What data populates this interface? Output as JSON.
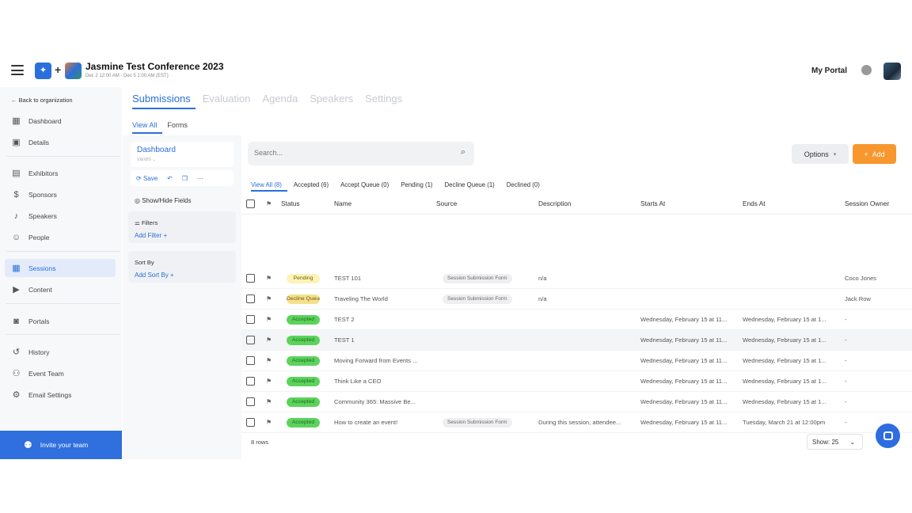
{
  "header": {
    "title": "Jasmine Test Conference 2023",
    "dates": "Dec 2 12:00 AM - Dec 5 1:00 AM (EST)",
    "my_portal": "My Portal"
  },
  "sidebar": {
    "back": "← Back to organization",
    "items": [
      {
        "label": "Dashboard",
        "icon": "dashboard-icon"
      },
      {
        "label": "Details",
        "icon": "calendar-icon"
      },
      {
        "label": "Exhibitors",
        "icon": "store-icon"
      },
      {
        "label": "Sponsors",
        "icon": "dollar-icon"
      },
      {
        "label": "Speakers",
        "icon": "microphone-icon"
      },
      {
        "label": "People",
        "icon": "person-icon"
      },
      {
        "label": "Sessions",
        "icon": "grid-calendar-icon"
      },
      {
        "label": "Content",
        "icon": "play-icon"
      },
      {
        "label": "Portals",
        "icon": "portal-icon"
      },
      {
        "label": "History",
        "icon": "history-icon"
      },
      {
        "label": "Event Team",
        "icon": "team-icon"
      },
      {
        "label": "Email Settings",
        "icon": "gear-icon"
      }
    ],
    "invite": "Invite your team"
  },
  "tabs": [
    "Submissions",
    "Evaluation",
    "Agenda",
    "Speakers",
    "Settings"
  ],
  "subtabs": [
    "View All",
    "Forms"
  ],
  "views_panel": {
    "view_name": "Dashboard",
    "view_sub": "VIEWS ⌄",
    "save": "Save",
    "show_hide": "Show/Hide Fields",
    "filters": "Filters",
    "add_filter": "Add Filter",
    "sort_by": "Sort By",
    "add_sort": "Add Sort By"
  },
  "search": {
    "placeholder": "Search..."
  },
  "options_label": "Options",
  "add_label": "Add",
  "filter_tabs": [
    "View All (8)",
    "Accepted (6)",
    "Accept Queue (0)",
    "Pending (1)",
    "Decline Queue (1)",
    "Declined (0)"
  ],
  "table": {
    "columns": [
      "Status",
      "Name",
      "Source",
      "Description",
      "Starts At",
      "Ends At",
      "Session Owner"
    ],
    "rows": [
      {
        "status": "Pending",
        "name": "TEST 101",
        "source": "Session Submission Form",
        "description": "n/a",
        "starts": "",
        "ends": "",
        "owner": "Coco Jones"
      },
      {
        "status": "Decline Queue",
        "name": "Traveling The World",
        "source": "Session Submission Form",
        "description": "n/a",
        "starts": "",
        "ends": "",
        "owner": "Jack Row"
      },
      {
        "status": "Accepted",
        "name": "TEST 2",
        "source": "",
        "description": "",
        "starts": "Wednesday, February 15 at 11...",
        "ends": "Wednesday, February 15 at 1...",
        "owner": "-"
      },
      {
        "status": "Accepted",
        "name": "TEST 1",
        "source": "",
        "description": "",
        "starts": "Wednesday, February 15 at 11...",
        "ends": "Wednesday, February 15 at 1...",
        "owner": "-"
      },
      {
        "status": "Accepted",
        "name": "Moving Forward from Events ...",
        "source": "",
        "description": "",
        "starts": "Wednesday, February 15 at 11...",
        "ends": "Wednesday, February 15 at 1...",
        "owner": "-"
      },
      {
        "status": "Accepted",
        "name": "Think Like a CEO",
        "source": "",
        "description": "",
        "starts": "Wednesday, February 15 at 11...",
        "ends": "Wednesday, February 15 at 1...",
        "owner": "-"
      },
      {
        "status": "Accepted",
        "name": "Community 365: Massive Be...",
        "source": "",
        "description": "",
        "starts": "Wednesday, February 15 at 11...",
        "ends": "Wednesday, February 15 at 1...",
        "owner": "-"
      },
      {
        "status": "Accepted",
        "name": "How to create an event!",
        "source": "Session Submission Form",
        "description": "During this session, attendee...",
        "starts": "Wednesday, February 15 at 11...",
        "ends": "Tuesday, March 21 at 12:00pm",
        "owner": "-"
      }
    ]
  },
  "footer": {
    "rows": "8 rows",
    "show": "Show: 25"
  },
  "colors": {
    "accent": "#2a6fdb",
    "add_button": "#f7972e",
    "accepted": "#5bd35b"
  }
}
